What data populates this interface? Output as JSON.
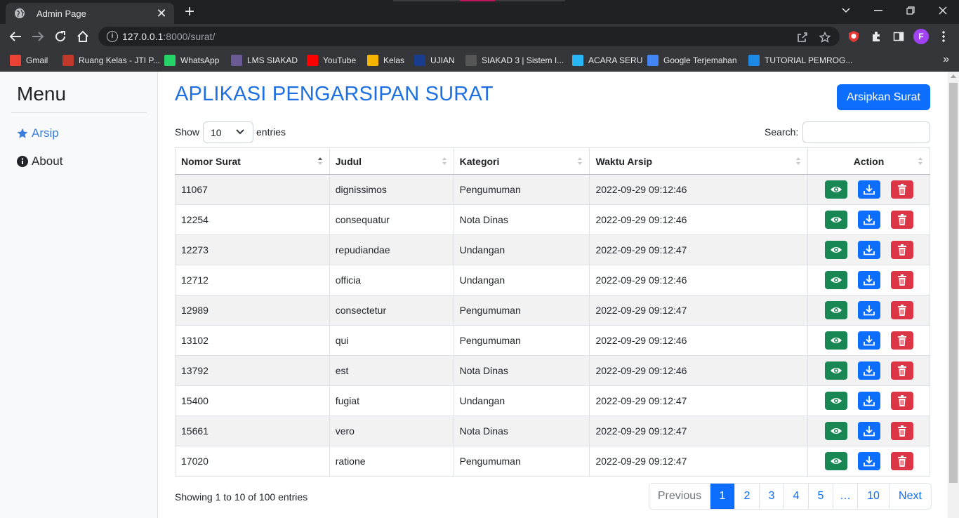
{
  "browser": {
    "tab_title": "Admin Page",
    "url_host": "127.0.0.1",
    "url_rest": ":8000/surat/",
    "profile_initial": "F",
    "bookmarks": [
      {
        "label": "Gmail",
        "icon": "gmail-icon",
        "color": "#ea4335"
      },
      {
        "label": "Ruang Kelas - JTI P...",
        "icon": "class-icon",
        "color": "#c0392b"
      },
      {
        "label": "WhatsApp",
        "icon": "whatsapp-icon",
        "color": "#25d366"
      },
      {
        "label": "LMS SIAKAD",
        "icon": "lms-icon",
        "color": "#6b5b95"
      },
      {
        "label": "YouTube",
        "icon": "youtube-icon",
        "color": "#ff0000"
      },
      {
        "label": "Kelas",
        "icon": "kelas-icon",
        "color": "#f4b400"
      },
      {
        "label": "UJIAN",
        "icon": "ujian-icon",
        "color": "#1a3c8f"
      },
      {
        "label": "SIAKAD 3 | Sistem I...",
        "icon": "siakad-icon",
        "color": "#555555"
      },
      {
        "label": "ACARA SERU",
        "icon": "acara-icon",
        "color": "#29b6f6"
      },
      {
        "label": "Google Terjemahan",
        "icon": "translate-icon",
        "color": "#4285f4"
      },
      {
        "label": "TUTORIAL PEMROG...",
        "icon": "tutorial-icon",
        "color": "#1e88e5"
      }
    ]
  },
  "sidebar": {
    "title": "Menu",
    "items": [
      {
        "label": "Arsip",
        "icon": "star-icon",
        "active": true
      },
      {
        "label": "About",
        "icon": "info-icon",
        "active": false
      }
    ]
  },
  "header": {
    "title": "APLIKASI PENGARSIPAN SURAT",
    "archive_button": "Arsipkan Surat"
  },
  "controls": {
    "show_label": "Show",
    "entries_value": "10",
    "entries_label": "entries",
    "search_label": "Search:",
    "search_value": ""
  },
  "table": {
    "headers": [
      "Nomor Surat",
      "Judul",
      "Kategori",
      "Waktu Arsip",
      "Action"
    ],
    "rows": [
      [
        "11067",
        "dignissimos",
        "Pengumuman",
        "2022-09-29 09:12:46"
      ],
      [
        "12254",
        "consequatur",
        "Nota Dinas",
        "2022-09-29 09:12:46"
      ],
      [
        "12273",
        "repudiandae",
        "Undangan",
        "2022-09-29 09:12:47"
      ],
      [
        "12712",
        "officia",
        "Undangan",
        "2022-09-29 09:12:46"
      ],
      [
        "12989",
        "consectetur",
        "Pengumuman",
        "2022-09-29 09:12:47"
      ],
      [
        "13102",
        "qui",
        "Pengumuman",
        "2022-09-29 09:12:46"
      ],
      [
        "13792",
        "est",
        "Nota Dinas",
        "2022-09-29 09:12:46"
      ],
      [
        "15400",
        "fugiat",
        "Undangan",
        "2022-09-29 09:12:47"
      ],
      [
        "15661",
        "vero",
        "Nota Dinas",
        "2022-09-29 09:12:47"
      ],
      [
        "17020",
        "ratione",
        "Pengumuman",
        "2022-09-29 09:12:47"
      ]
    ]
  },
  "footer": {
    "showing": "Showing 1 to 10 of 100 entries",
    "pagination": [
      "Previous",
      "1",
      "2",
      "3",
      "4",
      "5",
      "…",
      "10",
      "Next"
    ],
    "active_page": "1"
  },
  "colors": {
    "primary": "#0d6efd",
    "success": "#198754",
    "danger": "#dc3545",
    "title": "#1e6fe0"
  }
}
